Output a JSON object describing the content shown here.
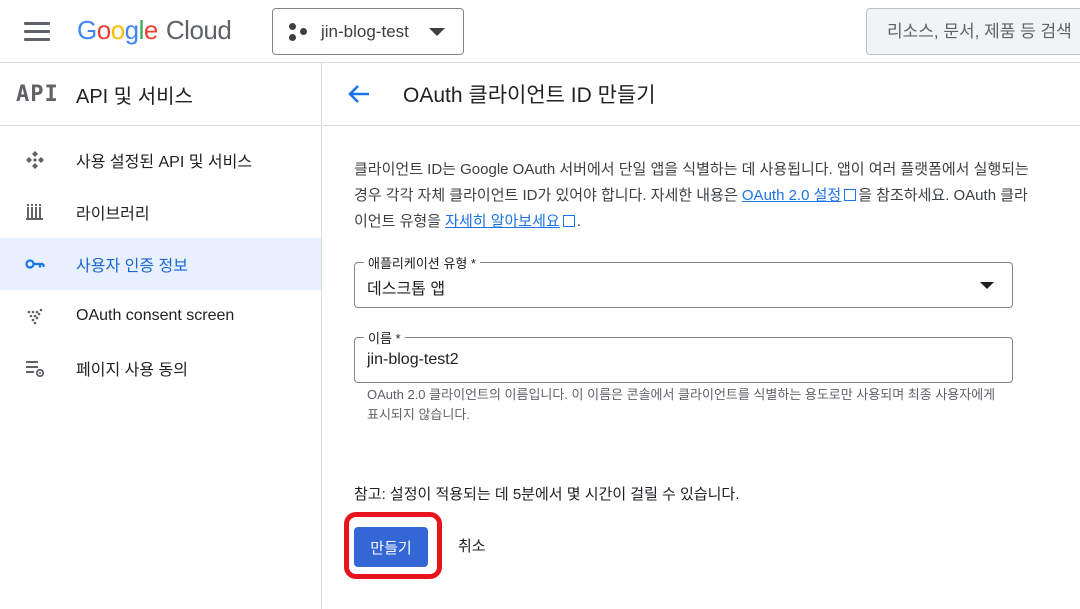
{
  "topbar": {
    "logo_google": "Google",
    "logo_cloud": "Cloud",
    "project_name": "jin-blog-test",
    "search_placeholder": "리소스, 문서, 제품 등 검색"
  },
  "sidebar": {
    "badge": "API",
    "title": "API 및 서비스",
    "items": [
      {
        "label": "사용 설정된 API 및 서비스",
        "icon": "enabled-apis-icon"
      },
      {
        "label": "라이브러리",
        "icon": "library-icon"
      },
      {
        "label": "사용자 인증 정보",
        "icon": "key-icon",
        "active": true
      },
      {
        "label": "OAuth consent screen",
        "icon": "consent-screen-icon"
      },
      {
        "label": "페이지 사용 동의",
        "icon": "page-usage-settings-icon"
      }
    ]
  },
  "main": {
    "title": "OAuth 클라이언트 ID 만들기",
    "desc_part1": "클라이언트 ID는 Google OAuth 서버에서 단일 앱을 식별하는 데 사용됩니다. 앱이 여러 플랫폼에서 실행되는 경우 각각 자체 클라이언트 ID가 있어야 합니다. 자세한 내용은 ",
    "desc_link1": "OAuth 2.0 설정",
    "desc_part2": "을 참조하세요. OAuth 클라이언트 유형을 ",
    "desc_link2": "자세히 알아보세요",
    "desc_part3": ".",
    "app_type": {
      "label": "애플리케이션 유형 *",
      "value": "데스크톱 앱"
    },
    "name": {
      "label": "이름 *",
      "value": "jin-blog-test2"
    },
    "name_hint": "OAuth 2.0 클라이언트의 이름입니다. 이 이름은 콘솔에서 클라이언트를 식별하는 용도로만 사용되며 최종 사용자에게 표시되지 않습니다.",
    "note": "참고: 설정이 적용되는 데 5분에서 몇 시간이 걸릴 수 있습니다.",
    "create_label": "만들기",
    "cancel_label": "취소"
  },
  "colors": {
    "accent": "#1a73e8",
    "primary_button": "#3367d6",
    "highlight": "#e8141d",
    "active_bg": "#e8f0fe"
  }
}
